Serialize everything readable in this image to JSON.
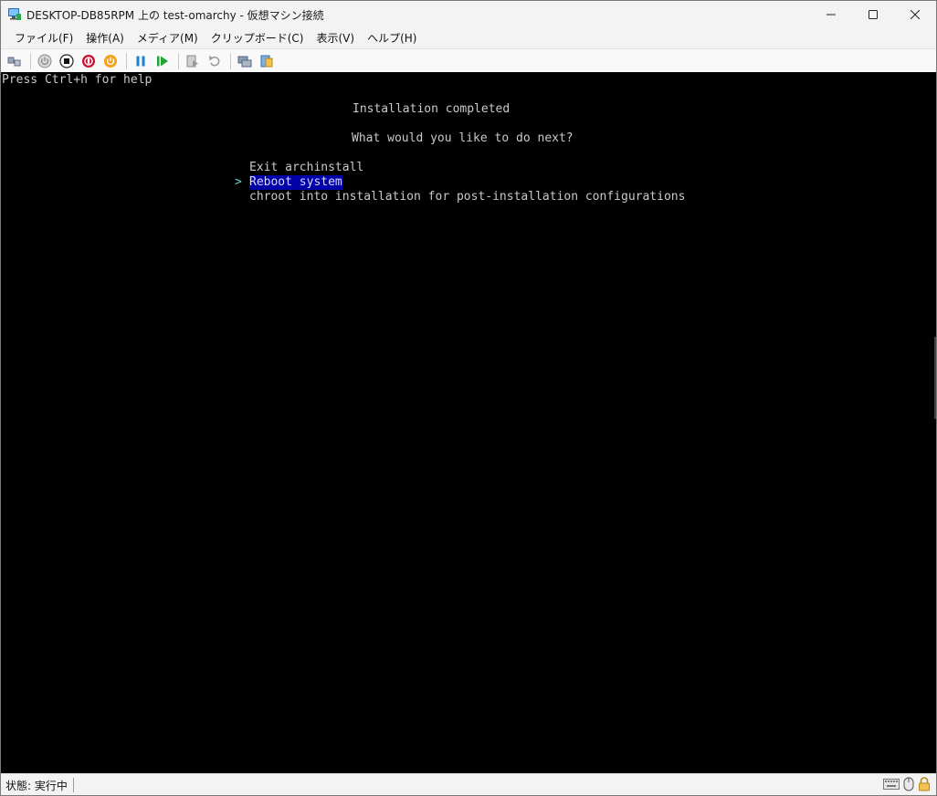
{
  "window": {
    "title": "DESKTOP-DB85RPM 上の test-omarchy  - 仮想マシン接続",
    "minimize_icon": "minimize-icon",
    "maximize_icon": "maximize-icon",
    "close_icon": "close-icon"
  },
  "menu": {
    "items": [
      {
        "label": "ファイル(F)"
      },
      {
        "label": "操作(A)"
      },
      {
        "label": "メディア(M)"
      },
      {
        "label": "クリップボード(C)"
      },
      {
        "label": "表示(V)"
      },
      {
        "label": "ヘルプ(H)"
      }
    ]
  },
  "toolbar": {
    "buttons": [
      {
        "icon": "ctrl-alt-del-icon"
      },
      {
        "icon": "start-icon"
      },
      {
        "icon": "turn-off-icon"
      },
      {
        "icon": "shut-down-icon"
      },
      {
        "icon": "save-icon"
      },
      {
        "icon": "pause-icon"
      },
      {
        "icon": "resume-icon"
      },
      {
        "icon": "checkpoint-icon"
      },
      {
        "icon": "revert-icon"
      },
      {
        "icon": "enhanced-session-icon"
      },
      {
        "icon": "share-icon"
      }
    ]
  },
  "console": {
    "help_line": "Press Ctrl+h for help",
    "heading": "Installation completed",
    "question": "What would you like to do next?",
    "cursor": ">",
    "options": [
      {
        "label": "Exit archinstall",
        "selected": false
      },
      {
        "label": "Reboot system",
        "selected": true
      },
      {
        "label": "chroot into installation for post-installation configurations",
        "selected": false
      }
    ],
    "highlight_color": "#0000a8",
    "text_color": "#c9c9c9"
  },
  "status": {
    "text": "状態: 実行中",
    "icons": [
      "keyboard-icon",
      "mouse-icon",
      "lock-icon"
    ]
  }
}
